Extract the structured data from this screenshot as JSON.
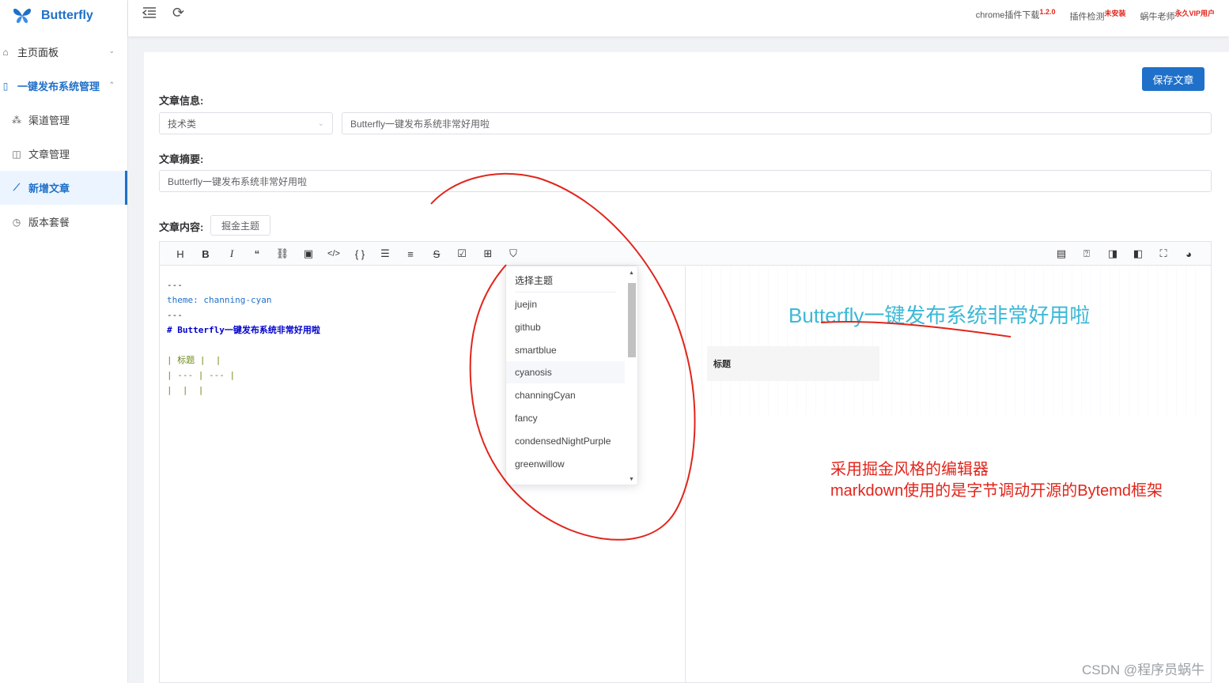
{
  "app": {
    "name": "Butterfly"
  },
  "sidebar": {
    "items": [
      {
        "label": "主页面板",
        "type": "top",
        "state": "collapsed"
      },
      {
        "label": "一键发布系统管理",
        "type": "top",
        "state": "open"
      },
      {
        "label": "渠道管理",
        "type": "sub"
      },
      {
        "label": "文章管理",
        "type": "sub"
      },
      {
        "label": "新增文章",
        "type": "sub",
        "state": "active"
      },
      {
        "label": "版本套餐",
        "type": "sub"
      }
    ]
  },
  "header": {
    "links": [
      {
        "label": "chrome插件下载",
        "badge": "1.2.0"
      },
      {
        "label": "插件检测",
        "badge": "未安装"
      },
      {
        "label": "蜗牛老师",
        "badge": "永久VIP用户"
      }
    ]
  },
  "form": {
    "save_label": "保存文章",
    "info_label": "文章信息:",
    "category_value": "技术类",
    "title_value": "Butterfly一键发布系统非常好用啦",
    "summary_label": "文章摘要:",
    "summary_value": "Butterfly一键发布系统非常好用啦",
    "content_label": "文章内容:",
    "theme_button": "掘金主题"
  },
  "editor": {
    "code_lines": [
      "---",
      "theme: channing-cyan",
      "---",
      "# Butterfly一键发布系统非常好用啦",
      "",
      "| 标题 |  |",
      "| --- | --- |",
      "|  |  |"
    ],
    "preview_title": "Butterfly一键发布系统非常好用啦",
    "preview_table_header": "标题"
  },
  "theme_dropdown": {
    "header": "选择主题",
    "options": [
      "juejin",
      "github",
      "smartblue",
      "cyanosis",
      "channingCyan",
      "fancy",
      "condensedNightPurple",
      "greenwillow"
    ],
    "highlighted": "cyanosis"
  },
  "annotations": {
    "line1": "采用掘金风格的编辑器",
    "line2": "markdown使用的是字节调动开源的Bytemd框架"
  },
  "watermark": "CSDN @程序员蜗牛",
  "colors": {
    "primary": "#1f70c9",
    "annotation": "#e1251b",
    "preview_title": "#3db8d6"
  }
}
